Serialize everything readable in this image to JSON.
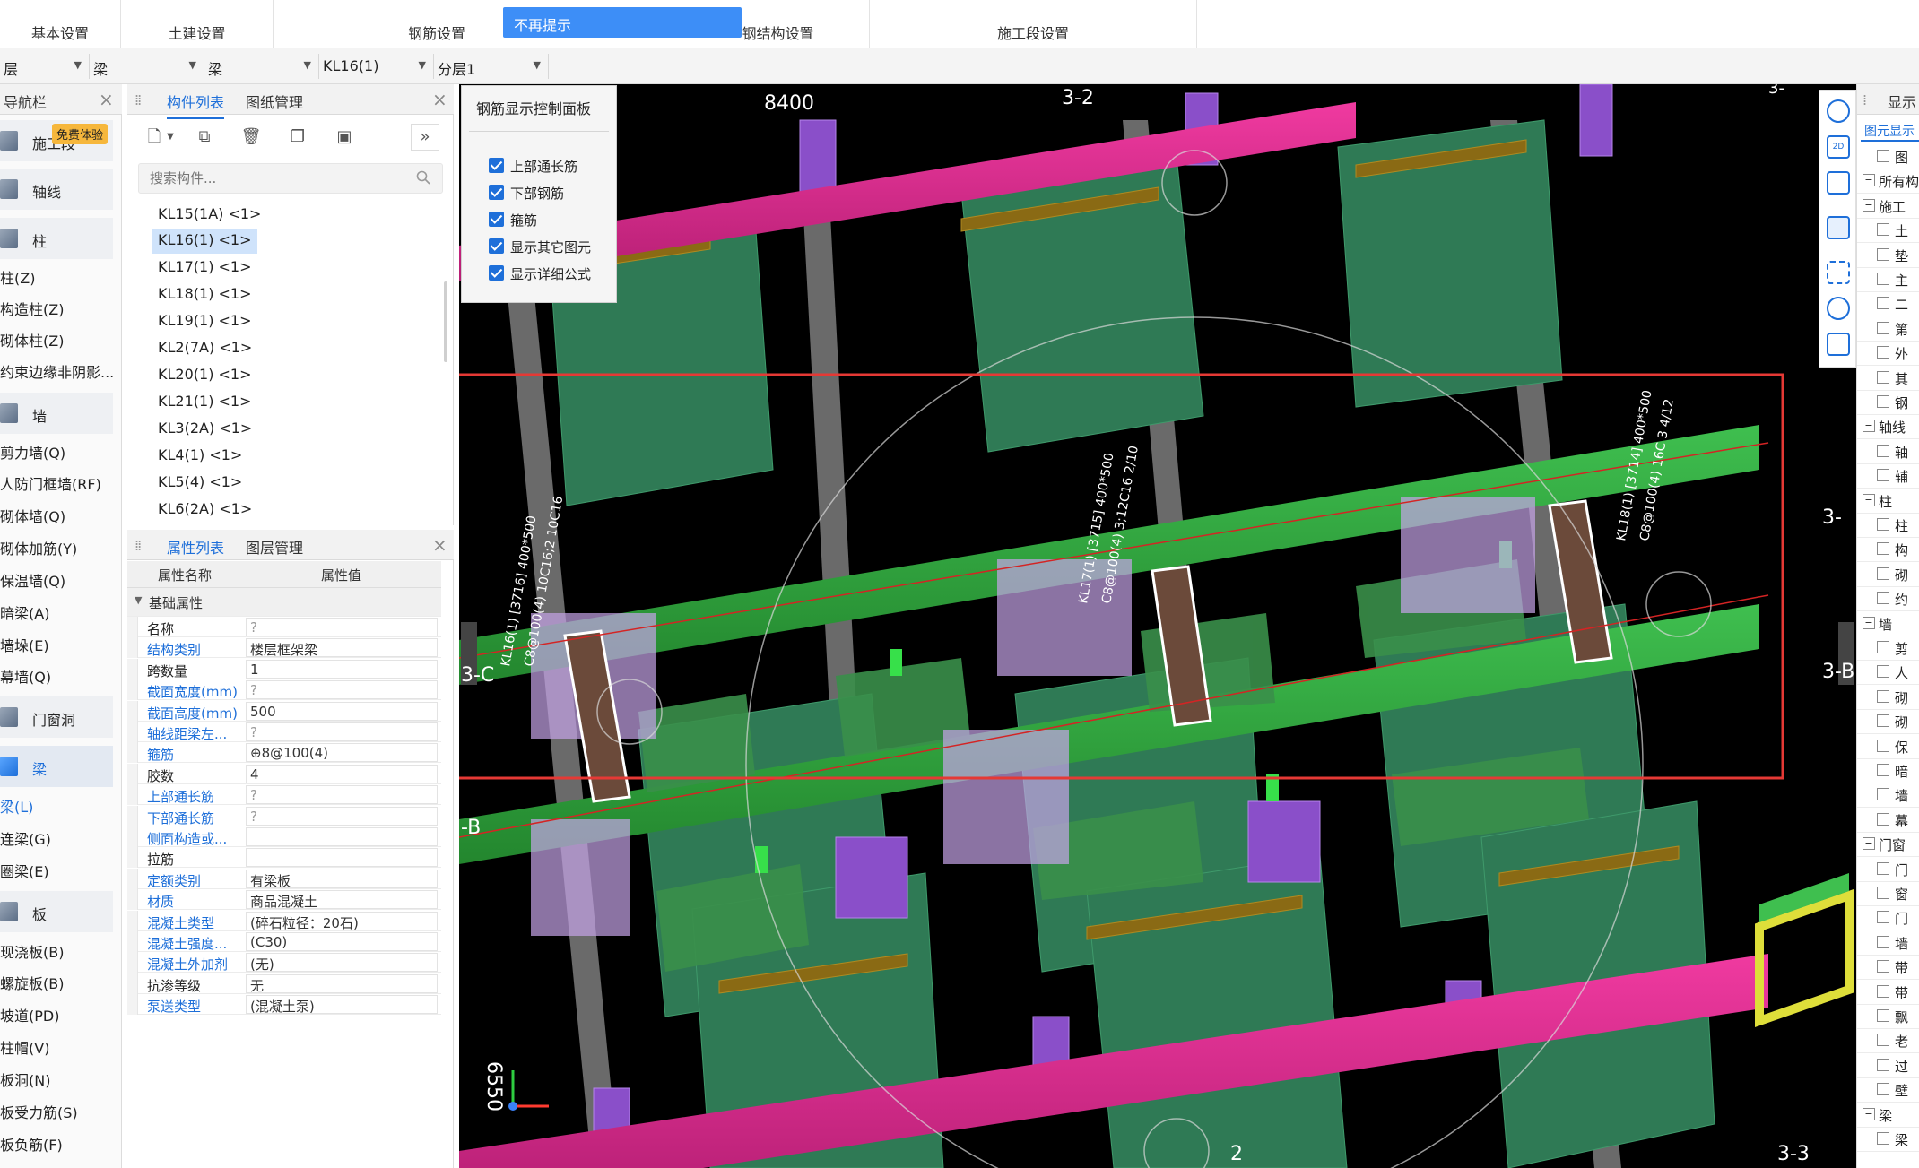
{
  "ribbon": {
    "groups": [
      "基本设置",
      "土建设置",
      "钢筋设置",
      "钢结构设置",
      "施工段设置"
    ],
    "toast": "不再提示"
  },
  "selectors": [
    "层",
    "梁",
    "梁",
    "KL16(1)",
    "分层1"
  ],
  "nav": {
    "title": "导航栏",
    "badge": "免费体验",
    "categories": [
      {
        "label": "施工段",
        "items": []
      },
      {
        "label": "轴线",
        "items": []
      },
      {
        "label": "柱",
        "items": [
          "柱(Z)",
          "构造柱(Z)",
          "砌体柱(Z)",
          "约束边缘非阴影..."
        ]
      },
      {
        "label": "墙",
        "items": [
          "剪力墙(Q)",
          "人防门框墙(RF)",
          "砌体墙(Q)",
          "砌体加筋(Y)",
          "保温墙(Q)",
          "暗梁(A)",
          "墙垛(E)",
          "幕墙(Q)"
        ]
      },
      {
        "label": "门窗洞",
        "items": []
      },
      {
        "label": "梁",
        "items": [
          "梁(L)",
          "连梁(G)",
          "圈梁(E)"
        ]
      },
      {
        "label": "板",
        "items": [
          "现浇板(B)",
          "螺旋板(B)",
          "坡道(PD)",
          "柱帽(V)",
          "板洞(N)",
          "板受力筋(S)",
          "板负筋(F)"
        ]
      }
    ]
  },
  "component_list": {
    "tabs": [
      "构件列表",
      "图纸管理"
    ],
    "search_placeholder": "搜索构件...",
    "items": [
      "KL15(1A) <1>",
      "KL16(1) <1>",
      "KL17(1) <1>",
      "KL18(1) <1>",
      "KL19(1) <1>",
      "KL2(7A) <1>",
      "KL20(1) <1>",
      "KL21(1) <1>",
      "KL3(2A) <1>",
      "KL4(1) <1>",
      "KL5(4) <1>",
      "KL6(2A) <1>"
    ],
    "selected": "KL16(1) <1>"
  },
  "property_list": {
    "tabs": [
      "属性列表",
      "图层管理"
    ],
    "headers": [
      "属性名称",
      "属性值"
    ],
    "group": "基础属性",
    "rows": [
      {
        "name": "名称",
        "value": "?"
      },
      {
        "name": "结构类别",
        "value": "楼层框架梁"
      },
      {
        "name": "跨数量",
        "value": "1"
      },
      {
        "name": "截面宽度(mm)",
        "value": "?"
      },
      {
        "name": "截面高度(mm)",
        "value": "500"
      },
      {
        "name": "轴线距梁左...",
        "value": "?"
      },
      {
        "name": "箍筋",
        "value": "⊕8@100(4)"
      },
      {
        "name": "胶数",
        "value": "4"
      },
      {
        "name": "上部通长筋",
        "value": "?"
      },
      {
        "name": "下部通长筋",
        "value": "?"
      },
      {
        "name": "侧面构造或...",
        "value": ""
      },
      {
        "name": "拉筋",
        "value": ""
      },
      {
        "name": "定额类别",
        "value": "有梁板"
      },
      {
        "name": "材质",
        "value": "商品混凝土"
      },
      {
        "name": "混凝土类型",
        "value": "(碎石粒径：20石)"
      },
      {
        "name": "混凝土强度...",
        "value": "(C30)"
      },
      {
        "name": "混凝土外加剂",
        "value": "(无)"
      },
      {
        "name": "抗渗等级",
        "value": "无"
      },
      {
        "name": "泵送类型",
        "value": "(混凝土泵)"
      }
    ]
  },
  "rebar_panel": {
    "title": "钢筋显示控制面板",
    "options": [
      "上部通长筋",
      "下部钢筋",
      "箍筋",
      "显示其它图元",
      "显示详细公式"
    ]
  },
  "viewport": {
    "dims": [
      "8400",
      "6550"
    ],
    "axis_labels": [
      "3-2",
      "3-C",
      "3-B",
      "-B",
      "3-3",
      "2",
      "3-",
      "3-"
    ],
    "beam_labels": [
      "KL16(1) [3716] 400*500",
      "C8@100(4) 10C16;2 10C16",
      "KL17(1) [3715] 400*500",
      "C8@100(4) 3;12C16 2/10",
      "KL18(1) [3714] 400*500",
      "C8@100(4) 16C 3 4/12"
    ],
    "colors": {
      "pink": "#e0308f",
      "green": "#2e9c3a",
      "dark_green": "#2f7a55",
      "purple": "#8a4fc9",
      "highlight": "#e53935"
    }
  },
  "display_panel": {
    "title": "显示",
    "tab": "图元显示",
    "rows": [
      "图",
      "所有构",
      "施工",
      "土",
      "垫",
      "主",
      "二",
      "第",
      "外",
      "其",
      "钢",
      "轴线",
      "轴",
      "辅",
      "柱",
      "柱",
      "构",
      "砌",
      "约",
      "墙",
      "剪",
      "人",
      "砌",
      "砌",
      "保",
      "暗",
      "墙",
      "幕",
      "门窗",
      "门",
      "窗",
      "门",
      "墙",
      "带",
      "带",
      "飘",
      "老",
      "过",
      "壁",
      "梁",
      "梁"
    ]
  },
  "right_toolbar": [
    "2D",
    "3D",
    "box",
    "select",
    "cube",
    "rebar"
  ]
}
